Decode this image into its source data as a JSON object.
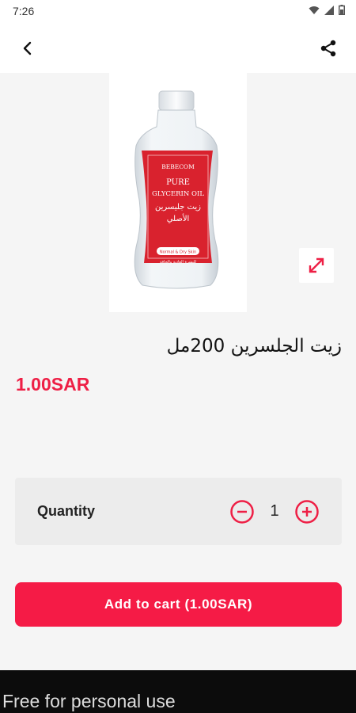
{
  "status_bar": {
    "time": "7:26"
  },
  "product": {
    "image_label": {
      "brand": "BEBECOM",
      "name_line1": "PURE",
      "name_line2": "GLYCERIN OIL",
      "arabic_line1": "زيت جليسرين",
      "arabic_line2": "الأصلي",
      "skin": "Normal & Dry Skin",
      "arabic_small": "للبشرة العادية والجافة"
    },
    "title": "زيت الجلسرين 200مل",
    "price": "1.00SAR"
  },
  "quantity": {
    "label": "Quantity",
    "value": "1"
  },
  "cart": {
    "add_label": "Add to cart (1.00SAR)"
  },
  "footer": {
    "text": "Free for personal use"
  },
  "colors": {
    "accent": "#f51b46",
    "price": "#ee1f45",
    "label_red": "#d9222e"
  },
  "icons": {
    "back": "chevron-left-icon",
    "share": "share-icon",
    "expand": "expand-icon",
    "minus": "minus-circle-icon",
    "plus": "plus-circle-icon"
  }
}
